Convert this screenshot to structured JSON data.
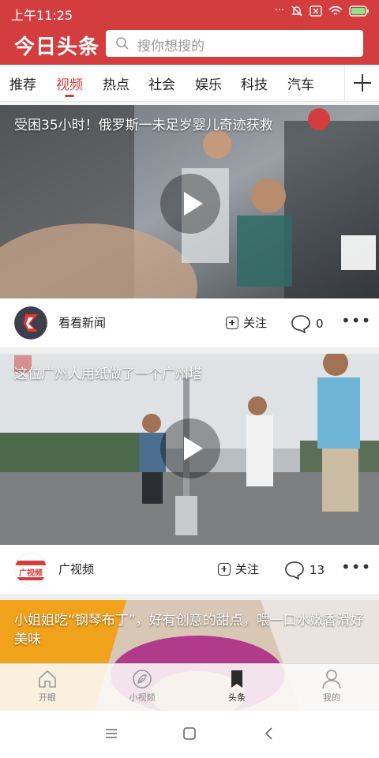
{
  "status": {
    "time": "上午11:25",
    "dots": "···"
  },
  "header": {
    "logo": "今日头条",
    "search_placeholder": "搜你想搜的"
  },
  "tabs": [
    {
      "label": "推荐"
    },
    {
      "label": "视频"
    },
    {
      "label": "热点"
    },
    {
      "label": "社会"
    },
    {
      "label": "娱乐"
    },
    {
      "label": "科技"
    },
    {
      "label": "汽车"
    }
  ],
  "feed": [
    {
      "title": "受困35小时！俄罗斯一未足岁婴儿奇迹获救",
      "source": "看看新闻",
      "follow": "关注",
      "comments": "0"
    },
    {
      "title": "这位广州人用纸做了一个广州塔",
      "source": "广视频",
      "avatar_text": "广视频",
      "follow": "关注",
      "comments": "13"
    },
    {
      "title": "小姐姐吃“钢琴布丁”，好有创意的甜点，喂一口水嫩香滑好美味"
    }
  ],
  "bottom_nav": [
    {
      "label": "开眼",
      "icon": "home-icon"
    },
    {
      "label": "小视频",
      "icon": "leaf-icon"
    },
    {
      "label": "头条",
      "icon": "bookmark-icon"
    },
    {
      "label": "我的",
      "icon": "user-icon"
    }
  ],
  "colors": {
    "brand": "#d43d3d"
  }
}
